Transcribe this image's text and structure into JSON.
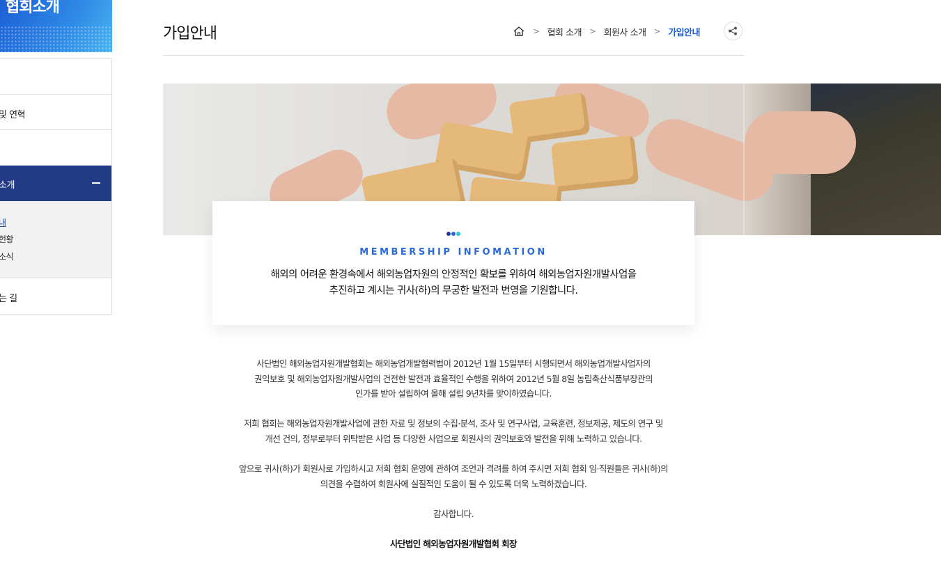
{
  "sidebar": {
    "title": "협회소개",
    "items": [
      {
        "label": ""
      },
      {
        "label": "및 연혁"
      },
      {
        "label": ""
      },
      {
        "label": "소개"
      },
      {
        "label": "는 길"
      }
    ],
    "sub_items": [
      "내",
      "현황",
      "소식"
    ]
  },
  "header": {
    "title": "가입안내",
    "breadcrumb": [
      "협회 소개",
      "회원사 소개",
      "가입안내"
    ],
    "separator": ">"
  },
  "card": {
    "heading": "MEMBERSHIP INFOMATION",
    "line1": "해외의 어려운 환경속에서 해외농업자원의 안정적인 확보를 위하여 해외농업자원개발사업을",
    "line2": "추진하고 계시는 귀사(하)의 무궁한 발전과 번영을 기원합니다.",
    "dot_colors": [
      "#233b86",
      "#2a6ad8",
      "#2fc4d8"
    ]
  },
  "body": {
    "p1": [
      "사단법인 해외농업자원개발협회는 해외농업개발협력법이 2012년 1월 15일부터 시행되면서 해외농업개발사업자의",
      "권익보호 및 해외농업자원개발사업의 건전한 발전과 효율적인 수행을 위하여 2012년 5월 8일 농림축산식품부장관의",
      "인가를 받아 설립하여 올해 설립 9년차를 맞이하였습니다."
    ],
    "p2": [
      "저희 협회는 해외농업자원개발사업에 관한 자료 및 정보의 수집·분석, 조사 및 연구사업, 교육훈련, 정보제공, 제도의 연구 및",
      "개선 건의, 정부로부터 위탁받은 사업 등 다양한 사업으로 회원사의 권익보호와 발전을 위해 노력하고 있습니다."
    ],
    "p3": [
      "앞으로 귀사(하)가 회원사로 가입하시고 저희 협회 운영에 관하여 조언과 격려를 하여 주시면 저희 협회 임·직원들은 귀사(하)의",
      "의견을 수렴하여 회원사에 실질적인 도움이 될 수 있도록 더욱 노력하겠습니다."
    ],
    "p4": "감사합니다.",
    "signature": "사단법인 해외농업자원개발협회 회장"
  },
  "icons": {
    "home": "home-icon",
    "share": "share-icon"
  },
  "colors": {
    "accent": "#1c5fd6",
    "sidebar_active": "#233b86"
  }
}
